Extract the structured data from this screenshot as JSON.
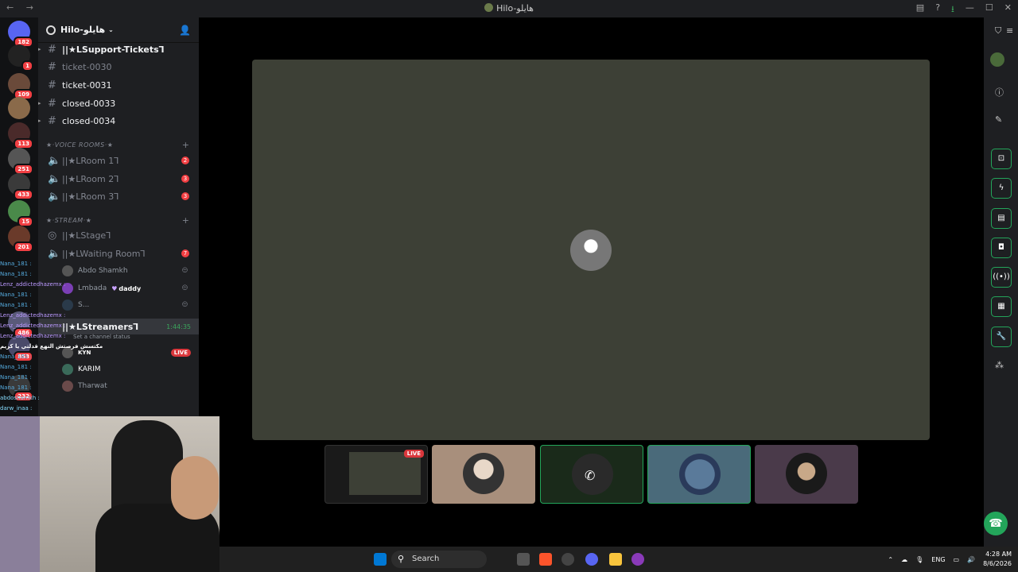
{
  "window": {
    "title": "Hilo-هايلو"
  },
  "server": {
    "name": "Hilo-هايلو"
  },
  "server_badges": [
    "182",
    "1",
    "109",
    "113",
    "251",
    "433",
    "15",
    "201",
    "486",
    "853",
    "232"
  ],
  "text_channels": [
    {
      "name": "||★LSupport-Tickets⅂",
      "bold": true
    },
    {
      "name": "ticket-0030",
      "muted": true
    },
    {
      "name": "ticket-0031"
    },
    {
      "name": "closed-0033"
    },
    {
      "name": "closed-0034"
    }
  ],
  "voice_category": "★·VOICE ROOMS·★",
  "voice_channels": [
    {
      "name": "||★LRoom 1⅂",
      "count": "2"
    },
    {
      "name": "||★LRoom 2⅂",
      "count": "3"
    },
    {
      "name": "||★LRoom 3⅂",
      "count": "3"
    }
  ],
  "stream_category": "★·STREAM·★",
  "stage_channel": "||★LStage⅂",
  "waiting_room": {
    "name": "||★LWaiting Room⅂",
    "count": "7"
  },
  "waiting_users": [
    "Abdo Shamkh",
    "Lmbada",
    "S..."
  ],
  "daddy_tag": "daddy",
  "streamers": {
    "name": "||★LStreamers⅂",
    "timer": "1:44:35",
    "status": "Set a channel status",
    "live": "LIVE"
  },
  "streamer_users": [
    "KYN",
    "KARIM",
    "Tharwat"
  ],
  "chat_lines": [
    {
      "user": "Nana_181 :",
      "msg": ""
    },
    {
      "user": "Nana_181 :",
      "msg": ""
    },
    {
      "user": "Lenz_addictedhazemx :",
      "msg": ""
    },
    {
      "user": "Nana_181 :",
      "msg": ""
    },
    {
      "user": "Nana_181 :",
      "msg": ""
    },
    {
      "user": "Lenz_addictedhazemx :",
      "msg": ""
    },
    {
      "user": "Lenz_addictedhazemx :",
      "msg": ""
    },
    {
      "user": "Lenz_addictedhazemx :",
      "msg": ""
    },
    {
      "user": "Lenz_addictedhazemx :",
      "msg": ""
    },
    {
      "user": "",
      "msg": "مكتسش فرصتش النهع قدلتي يا كريم"
    },
    {
      "user": "Nana_181 :",
      "msg": ""
    },
    {
      "user": "Nana_181 :",
      "msg": ""
    },
    {
      "user": "Nana_181 :",
      "msg": ""
    },
    {
      "user": "Nana_181 :",
      "msg": ""
    },
    {
      "user": "abdoshamkh :",
      "msg": ""
    },
    {
      "user": "darw_inaa :",
      "msg": ""
    }
  ],
  "tiles": [
    {
      "live": "LIVE"
    },
    {},
    {},
    {},
    {}
  ],
  "taskbar": {
    "search": "Search",
    "lang": "ENG",
    "time": "4:28 AM",
    "date": "8/6/2026"
  },
  "colors": {
    "accent_green": "#23a55a",
    "live_red": "#da373c",
    "badge_red": "#f23f43"
  }
}
